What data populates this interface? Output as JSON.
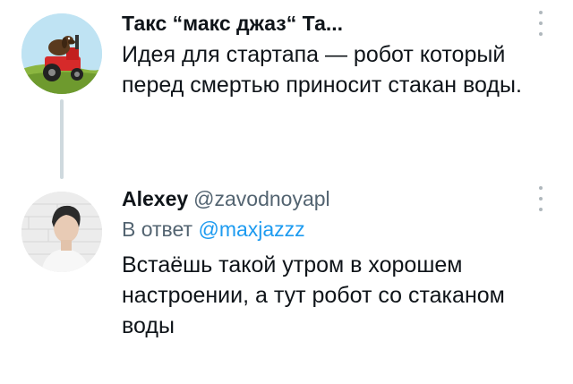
{
  "tweets": [
    {
      "author_name": "Такс “макс джаз“ Та...",
      "handle": "",
      "text": "Идея для стартапа — робот который перед смертью приносит стакан воды.",
      "avatar_icon": "dog-on-red-tractor-avatar"
    },
    {
      "author_name": "Alexey",
      "handle": "@zavodnoyapl",
      "reply_prefix": "В ответ",
      "reply_mention": "@maxjazzz",
      "text": "Встаёшь такой утром в хорошем настроении, а тут робот со стаканом воды",
      "avatar_icon": "person-photo-avatar"
    }
  ],
  "colors": {
    "text_primary": "#0f1419",
    "text_secondary": "#536471",
    "link": "#1d9bf0",
    "thread_line": "#cfd9de"
  }
}
